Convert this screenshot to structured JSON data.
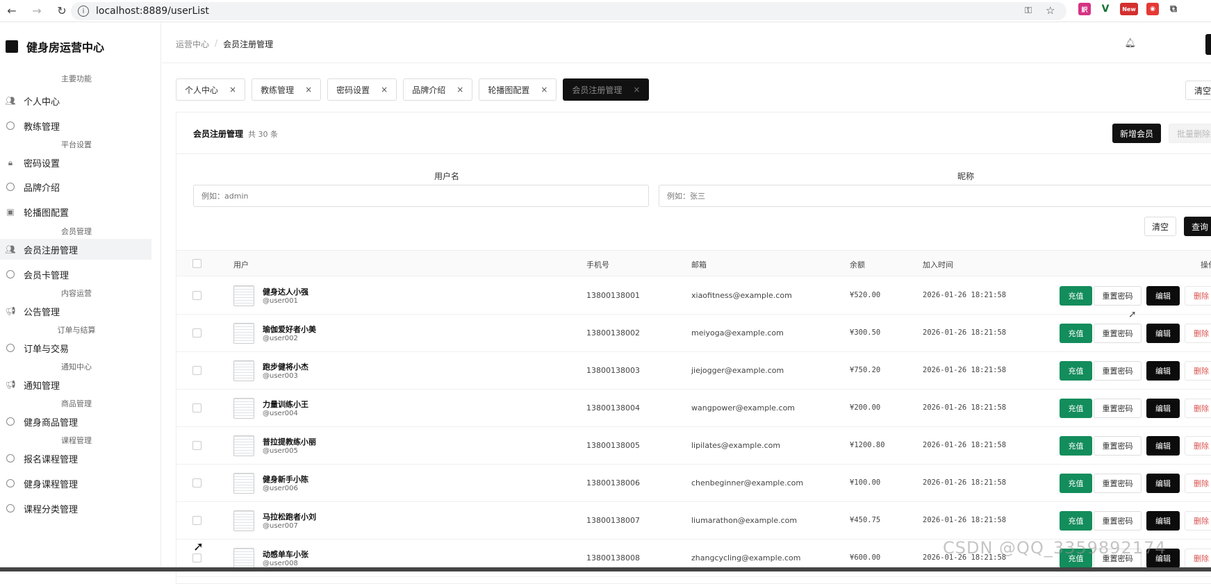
{
  "browser": {
    "url": "localhost:8889/userList",
    "ext_badge": "New"
  },
  "sidebar": {
    "brand": "健身房运营中心",
    "groups": [
      "主要功能",
      "平台设置",
      "会员管理",
      "内容运营",
      "订单与结算",
      "通知中心",
      "商品管理",
      "课程管理"
    ],
    "items": [
      {
        "label": "个人中心",
        "icon": "users-icon"
      },
      {
        "label": "教练管理",
        "icon": "circle-icon"
      },
      {
        "label": "密码设置",
        "icon": "lock-icon"
      },
      {
        "label": "品牌介绍",
        "icon": "circle-icon"
      },
      {
        "label": "轮播图配置",
        "icon": "image-icon"
      },
      {
        "label": "会员注册管理",
        "icon": "users-icon"
      },
      {
        "label": "会员卡管理",
        "icon": "circle-icon"
      },
      {
        "label": "公告管理",
        "icon": "megaphone-icon"
      },
      {
        "label": "订单与交易",
        "icon": "circle-icon"
      },
      {
        "label": "通知管理",
        "icon": "megaphone-icon"
      },
      {
        "label": "健身商品管理",
        "icon": "circle-icon"
      },
      {
        "label": "报名课程管理",
        "icon": "circle-icon"
      },
      {
        "label": "健身课程管理",
        "icon": "circle-icon"
      },
      {
        "label": "课程分类管理",
        "icon": "circle-icon"
      }
    ]
  },
  "header": {
    "breadcrumb_root": "运营中心",
    "breadcrumb_sep": "/",
    "breadcrumb_current": "会员注册管理"
  },
  "tabs": [
    {
      "label": "个人中心",
      "close": "×"
    },
    {
      "label": "教练管理",
      "close": "×"
    },
    {
      "label": "密码设置",
      "close": "×"
    },
    {
      "label": "品牌介绍",
      "close": "×"
    },
    {
      "label": "轮播图配置",
      "close": "×"
    },
    {
      "label": "会员注册管理",
      "close": "×"
    }
  ],
  "tabs_clear": "清空",
  "panel": {
    "title": "会员注册管理",
    "count": "共 30 条",
    "add_label": "新增会员",
    "batch_delete_label": "批量删除"
  },
  "filters": {
    "username_label": "用户名",
    "username_placeholder": "例如：admin",
    "nickname_label": "昵称",
    "nickname_placeholder": "例如：张三",
    "clear_label": "清空",
    "search_label": "查询"
  },
  "table": {
    "columns": [
      "用户",
      "手机号",
      "邮箱",
      "余额",
      "加入时间",
      "操作"
    ],
    "actions": {
      "recharge": "充值",
      "reset": "重置密码",
      "edit": "编辑",
      "delete": "删除"
    },
    "rows": [
      {
        "name": "健身达人小强",
        "id": "@user001",
        "phone": "13800138001",
        "email": "xiaofitness@example.com",
        "balance": "¥520.00",
        "joined": "2026-01-26 18:21:58"
      },
      {
        "name": "瑜伽爱好者小美",
        "id": "@user002",
        "phone": "13800138002",
        "email": "meiyoga@example.com",
        "balance": "¥300.50",
        "joined": "2026-01-26 18:21:58"
      },
      {
        "name": "跑步健将小杰",
        "id": "@user003",
        "phone": "13800138003",
        "email": "jiejogger@example.com",
        "balance": "¥750.20",
        "joined": "2026-01-26 18:21:58"
      },
      {
        "name": "力量训练小王",
        "id": "@user004",
        "phone": "13800138004",
        "email": "wangpower@example.com",
        "balance": "¥200.00",
        "joined": "2026-01-26 18:21:58"
      },
      {
        "name": "普拉提教练小丽",
        "id": "@user005",
        "phone": "13800138005",
        "email": "lipilates@example.com",
        "balance": "¥1200.80",
        "joined": "2026-01-26 18:21:58"
      },
      {
        "name": "健身新手小陈",
        "id": "@user006",
        "phone": "13800138006",
        "email": "chenbeginner@example.com",
        "balance": "¥100.00",
        "joined": "2026-01-26 18:21:58"
      },
      {
        "name": "马拉松跑者小刘",
        "id": "@user007",
        "phone": "13800138007",
        "email": "liumarathon@example.com",
        "balance": "¥450.75",
        "joined": "2026-01-26 18:21:58"
      },
      {
        "name": "动感单车小张",
        "id": "@user008",
        "phone": "13800138008",
        "email": "zhangcycling@example.com",
        "balance": "¥600.00",
        "joined": "2026-01-26 18:21:58"
      }
    ]
  },
  "watermark": "CSDN @QQ_3359892174",
  "colors": {
    "accent": "#111111",
    "recharge": "#138d5c",
    "danger": "#d9534f"
  }
}
